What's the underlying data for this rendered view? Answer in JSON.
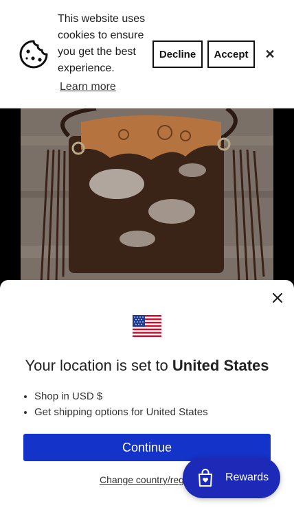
{
  "cookie_banner": {
    "message": "This website uses cookies to ensure you get the best experience.",
    "learn_more": "Learn more",
    "decline_label": "Decline",
    "accept_label": "Accept",
    "close_symbol": "✕",
    "icon": "cookie-icon"
  },
  "product": {
    "image": "product-photo"
  },
  "location_modal": {
    "title_prefix": "Your location is set to",
    "country": "United States",
    "bullets": [
      "Shop in USD $",
      "Get shipping options for United States"
    ],
    "continue_label": "Continue",
    "change_link": "Change country/region",
    "flag": "us-flag-icon",
    "close_icon": "close-icon"
  },
  "rewards": {
    "label": "Rewards",
    "icon": "shopping-bag-heart-icon",
    "color": "#1d2ab8"
  },
  "colors": {
    "primary_button": "#1433c8",
    "rewards_bg": "#1d2ab8"
  }
}
